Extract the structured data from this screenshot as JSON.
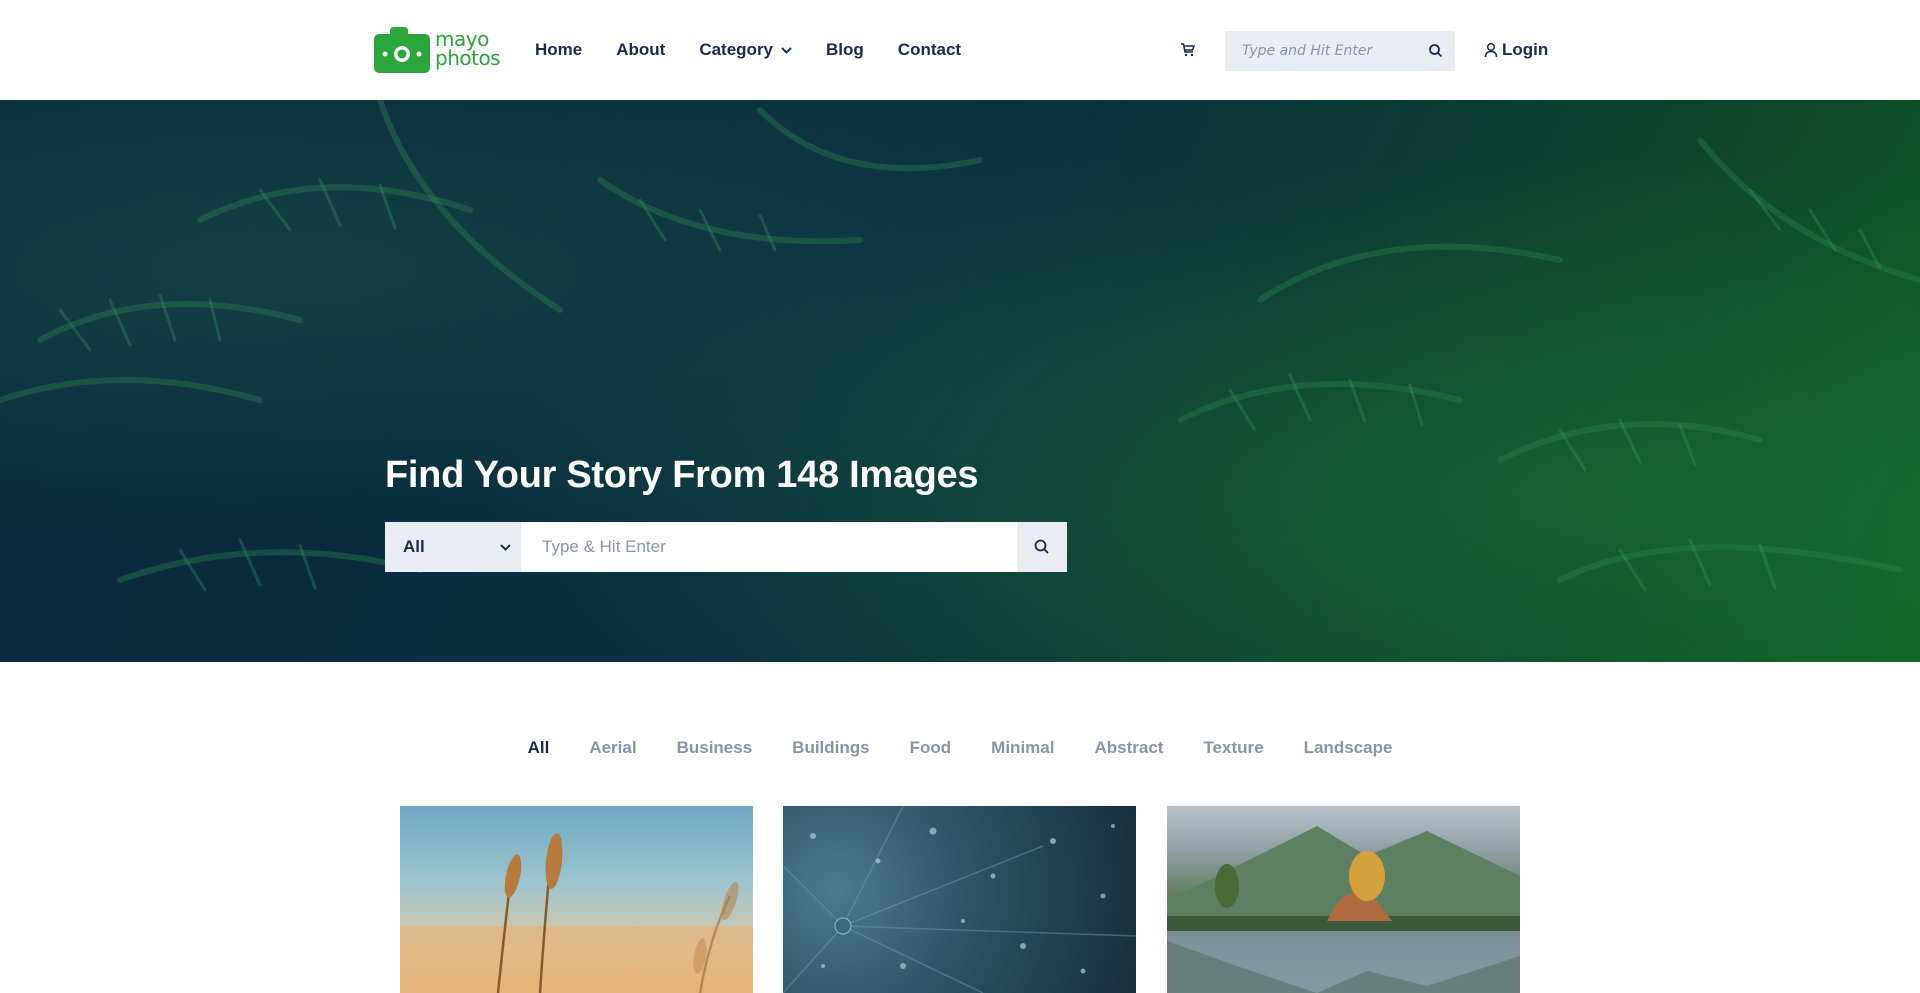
{
  "brand": {
    "logo_line1": "mayo",
    "logo_line2": "photos",
    "accent": "#2aa63a"
  },
  "nav": {
    "items": [
      {
        "label": "Home"
      },
      {
        "label": "About"
      },
      {
        "label": "Category",
        "has_dropdown": true
      },
      {
        "label": "Blog"
      },
      {
        "label": "Contact"
      }
    ]
  },
  "header": {
    "cart_icon": "cart-icon",
    "search_placeholder": "Type and Hit Enter",
    "search_icon": "search-icon",
    "login_label": "Login",
    "login_icon": "user-icon"
  },
  "hero": {
    "title": "Find Your Story From 148 Images",
    "select_value": "All",
    "search_placeholder": "Type & Hit Enter",
    "search_icon": "search-icon"
  },
  "filters": {
    "items": [
      "All",
      "Aerial",
      "Business",
      "Buildings",
      "Food",
      "Minimal",
      "Abstract",
      "Texture",
      "Landscape"
    ],
    "active": "All"
  },
  "gallery": {
    "items": [
      {
        "subject": "wheat"
      },
      {
        "subject": "raindrops"
      },
      {
        "subject": "mountain-lake"
      }
    ]
  },
  "colors": {
    "text": "#1b2a4e",
    "muted": "#8a94a6",
    "field": "#e9ecf3"
  }
}
